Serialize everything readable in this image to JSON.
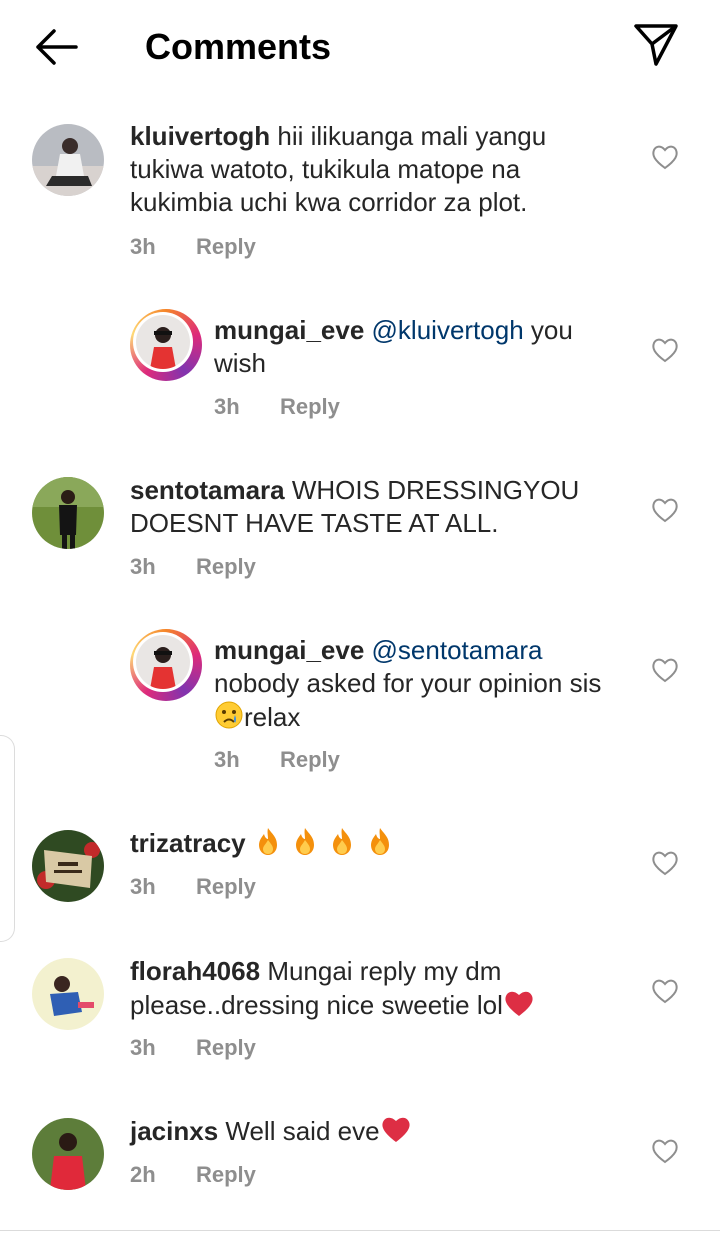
{
  "header": {
    "title": "Comments",
    "back_icon": "arrow-left-icon",
    "share_icon": "paper-plane-icon"
  },
  "reply_label": "Reply",
  "comments": [
    {
      "username": "kluivertogh",
      "text": "hii ilikuanga mali yangu tukiwa watoto, tukikula matope na kukimbia uchi kwa corridor za plot.",
      "time": "3h"
    },
    {
      "username": "mungai_eve",
      "mention": "@kluivertogh",
      "text": " you wish",
      "time": "3h"
    },
    {
      "username": "sentotamara",
      "text": "WHOIS DRESSINGYOU DOESNT HAVE TASTE AT ALL.",
      "time": "3h"
    },
    {
      "username": "mungai_eve",
      "mention": "@sentotamara",
      "text": "nobody asked for your opinion sis",
      "text_after": "relax",
      "time": "3h"
    },
    {
      "username": "trizatracy",
      "text": "",
      "time": "3h"
    },
    {
      "username": "florah4068",
      "text": "Mungai reply my dm please..dressing nice sweetie lol",
      "time": "3h"
    },
    {
      "username": "jacinxs",
      "text": "Well said eve",
      "time": "2h"
    }
  ],
  "colors": {
    "mention": "#00376b",
    "meta": "#8e8e8e",
    "text": "#262626"
  }
}
